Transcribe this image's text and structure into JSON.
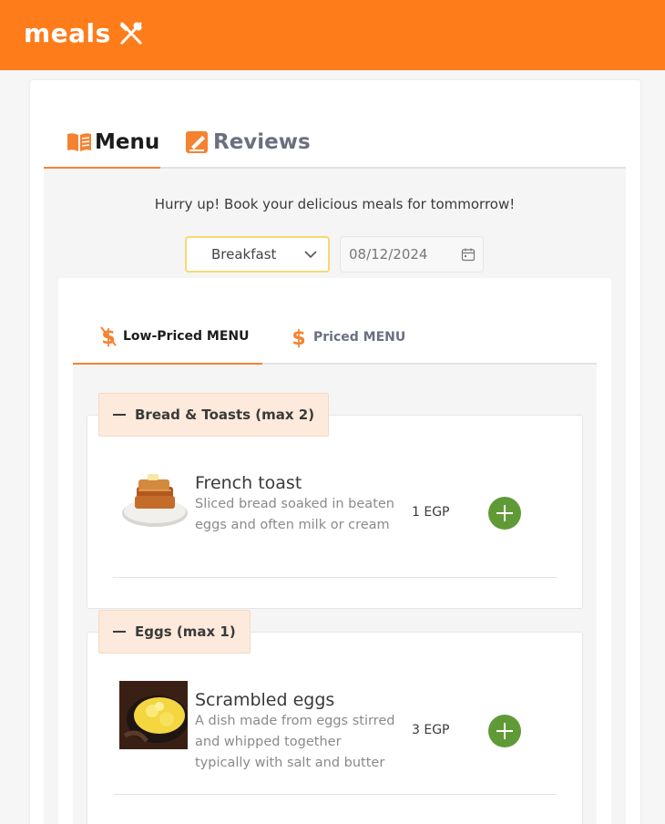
{
  "header": {
    "brand": "meals",
    "brand_icon": "fork-knife-icon",
    "bg_color": "#ff7c1a"
  },
  "main_tabs": [
    {
      "label": "Menu",
      "icon": "book-icon",
      "active": true
    },
    {
      "label": "Reviews",
      "icon": "pencil-icon",
      "active": false
    }
  ],
  "promo_text": "Hurry up! Book your delicious meals for tommorrow!",
  "filters": {
    "meal_type": {
      "selected": "Breakfast"
    },
    "date": {
      "value": "08/12/2024"
    }
  },
  "sub_tabs": [
    {
      "label": "Low-Priced MENU",
      "icon": "dollar-slash-icon",
      "active": true
    },
    {
      "label": "Priced MENU",
      "icon": "dollar-icon",
      "active": false
    }
  ],
  "categories": [
    {
      "title": "Bread & Toasts (max 2)",
      "items": [
        {
          "name": "French toast",
          "description": "Sliced bread soaked in beaten eggs and often milk or cream",
          "price": "1 EGP"
        }
      ]
    },
    {
      "title": "Eggs (max 1)",
      "items": [
        {
          "name": "Scrambled eggs",
          "description": "A dish made from eggs stirred and whipped together typically with salt and butter",
          "price": "3 EGP"
        }
      ]
    }
  ],
  "colors": {
    "accent": "#f58231",
    "add_button": "#5f9a36",
    "category_bg": "#fdeadc"
  }
}
